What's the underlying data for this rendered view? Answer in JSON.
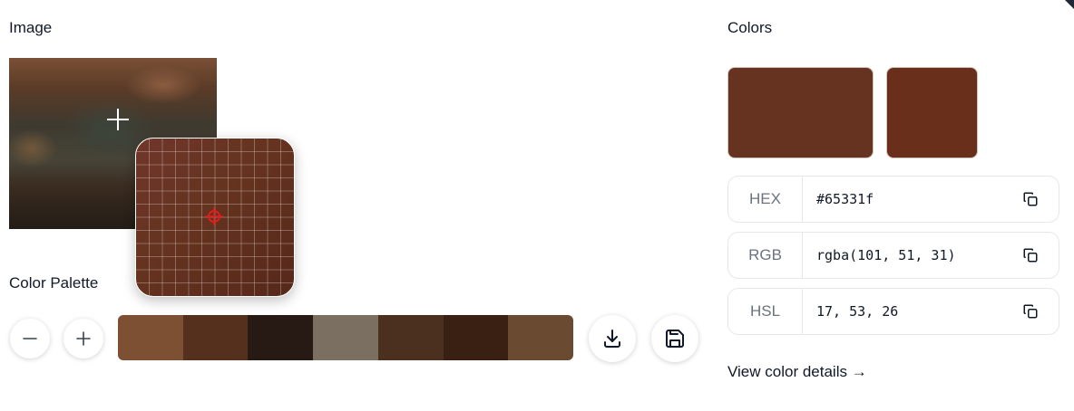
{
  "image_section": {
    "title": "Image"
  },
  "palette_section": {
    "title": "Color Palette",
    "swatches": [
      "#7d4f33",
      "#55301c",
      "#271914",
      "#7b6f62",
      "#4b2f1f",
      "#3a2013",
      "#6b4a32"
    ]
  },
  "colors_section": {
    "title": "Colors",
    "primary_color": "#65331f",
    "secondary_color": "#6a2f1b",
    "rows": [
      {
        "label": "HEX",
        "value": "#65331f"
      },
      {
        "label": "RGB",
        "value": "rgba(101, 51, 31)"
      },
      {
        "label": "HSL",
        "value": "17, 53, 26"
      }
    ],
    "details_link": "View color details →"
  },
  "icons": {
    "minus": "minus-icon",
    "plus": "plus-icon",
    "download": "download-icon",
    "save": "save-icon",
    "copy": "copy-icon",
    "crosshair": "crosshair-icon"
  }
}
